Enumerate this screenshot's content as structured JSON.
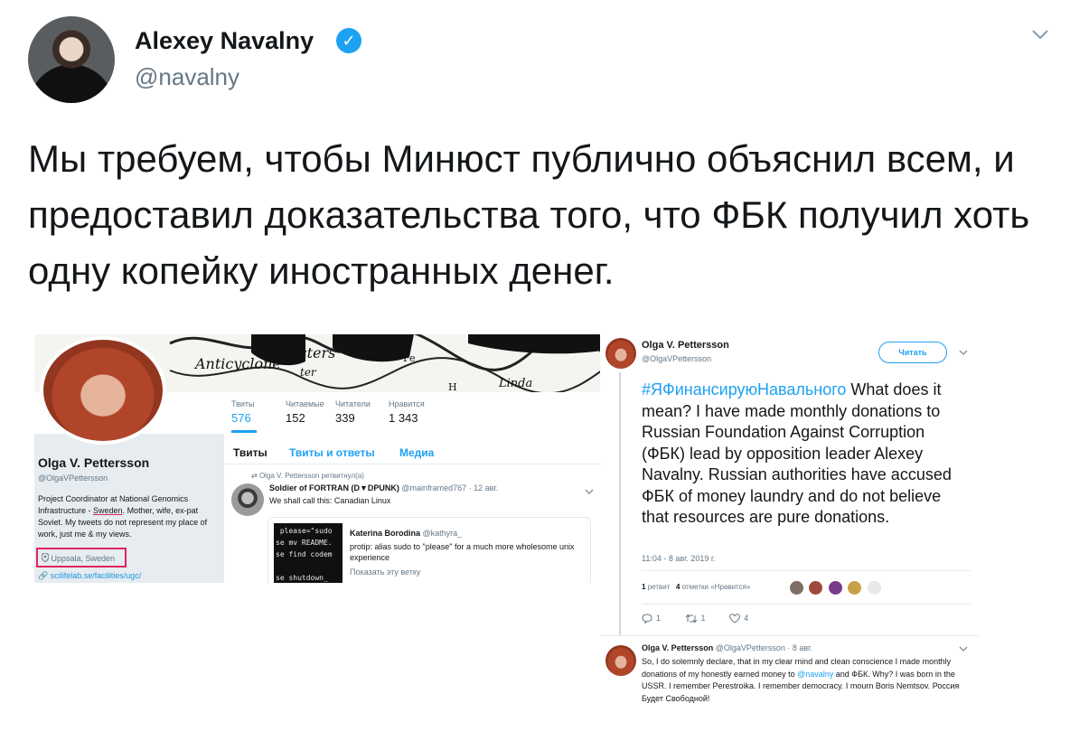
{
  "tweet": {
    "author_name": "Alexey Navalny",
    "verified_glyph": "✓",
    "author_handle": "@navalny",
    "text": "Мы требуем, чтобы Минюст публично объяснил всем, и предоставил доказательства того, что ФБК получил хоть одну копейку иностранных денег."
  },
  "profile_shot": {
    "stats": [
      {
        "label": "Твиты",
        "value": "576"
      },
      {
        "label": "Читаемые",
        "value": "152"
      },
      {
        "label": "Читатели",
        "value": "339"
      },
      {
        "label": "Нравится",
        "value": "1 343"
      }
    ],
    "name": "Olga V. Pettersson",
    "handle": "@OlgaVPettersson",
    "bio_before": "Project Coordinator at National Genomics Infrastructure - ",
    "bio_country": "Sweden",
    "bio_after": ". Mother, wife, ex-pat Soviet. My tweets do not represent my place of work, just me & my views.",
    "location": "Uppsala, Sweden",
    "link": "scilifelab.se/facilities/ugc/",
    "tabs": [
      "Твиты",
      "Твиты и ответы",
      "Медиа"
    ],
    "retweeted_line": "Olga V. Pettersson ретвитнул(а)",
    "rt_author": "Soldier of FORTRAN (D▼DPUNK)",
    "rt_meta": "@mainframed767 · 12 авг.",
    "rt_text": "We shall call this: Canadian Linux",
    "terminal": " please=\"sudo\nse mv README.\nse find codem\n\nse shutdown_",
    "quote_author": "Katerina Borodina",
    "quote_handle": "@kathyra_",
    "quote_text": "protip: alias sudo to \"please\" for a much more wholesome unix experience",
    "quote_more": "Показать эту ветку",
    "banner_words": [
      "Anticyclone",
      "Cisters",
      "ter",
      "Fe",
      "Fe",
      "Linda",
      "H"
    ]
  },
  "tweet_shot": {
    "name": "Olga V. Pettersson",
    "handle": "@OlgaVPettersson",
    "follow_label": "Читать",
    "hashtag": "#ЯФинансируюНавального",
    "text": " What does it mean? I have made monthly donations to Russian Foundation Against Corruption (ФБК) lead by opposition leader Alexey Navalny. Russian authorities have accused ФБК of money laundry and do not believe that resources are pure donations.",
    "time": "11:04 - 8 авг. 2019 г.",
    "retweets_count": "1",
    "retweets_label": "ретвит",
    "likes_count": "4",
    "likes_label": "отметки «Нравится»",
    "actions": {
      "reply": "1",
      "retweet": "1",
      "like": "4"
    },
    "reply": {
      "name": "Olga V. Pettersson",
      "meta": "@OlgaVPettersson · 8 авг.",
      "text_before": "So, I do solemnly declare, that in my clear mind and clean conscience I made monthly donations of my honestly earned money to ",
      "mention": "@navalny",
      "text_after": " and ФБК. Why? I was born in the USSR. I remember Perestroika. I remember democracy. I mourn Boris Nemtsov. Россия Будет Свободной!"
    }
  },
  "colors": {
    "accent": "#1da1f2",
    "text": "#14171a",
    "secondary": "#657786",
    "highlight_box": "#e0245e",
    "profile_bg": "#e6ecf0"
  }
}
